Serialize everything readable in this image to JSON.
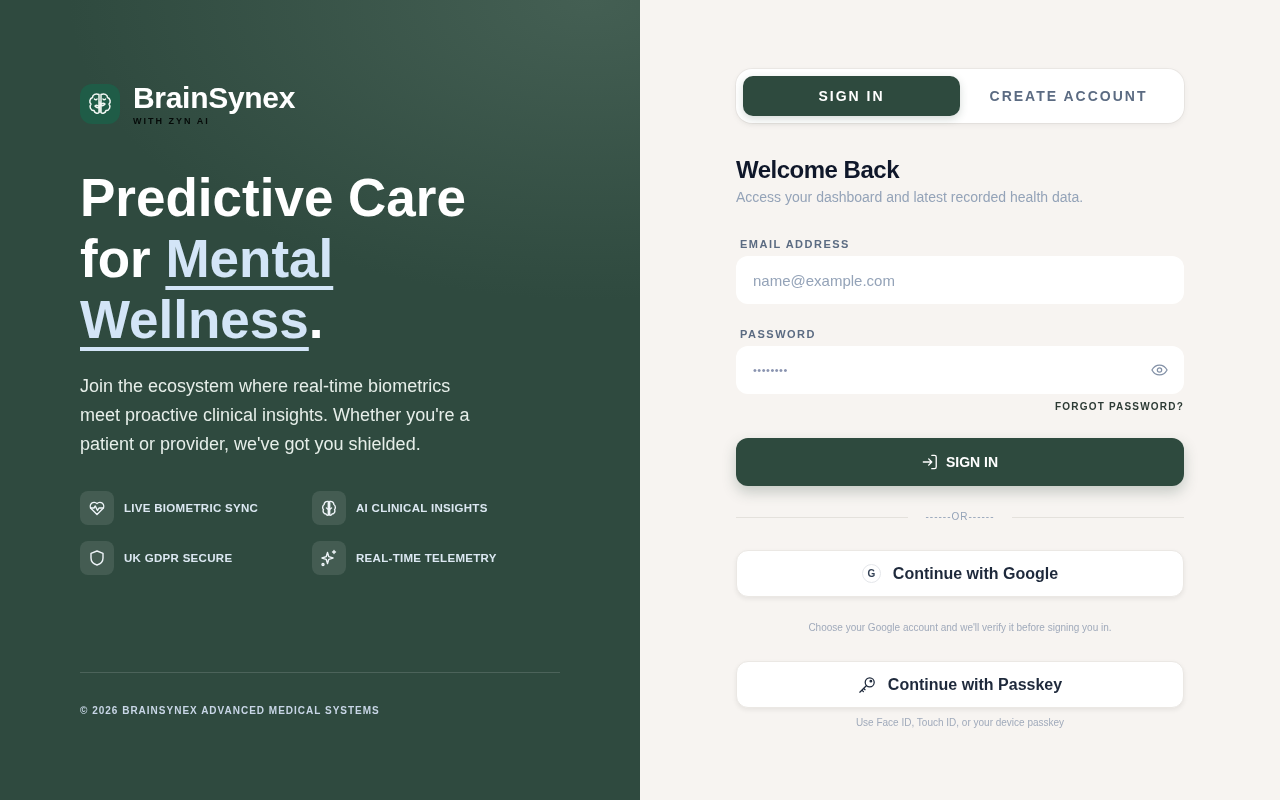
{
  "brand": {
    "name": "BrainSynex",
    "tagline": "WITH ZYN AI"
  },
  "hero": {
    "headline_start": "Predictive Care for",
    "headline_highlight": "Mental Wellness",
    "headline_end": ".",
    "body": "Join the ecosystem where real-time biometrics meet proactive clinical insights. Whether you're a patient or provider, we've got you shielded."
  },
  "features": [
    {
      "kind": "heart-pulse",
      "label": "LIVE BIOMETRIC SYNC"
    },
    {
      "kind": "brain",
      "label": "AI CLINICAL INSIGHTS"
    },
    {
      "kind": "shield",
      "label": "UK GDPR SECURE"
    },
    {
      "kind": "sparkle",
      "label": "REAL-TIME TELEMETRY"
    }
  ],
  "footer": "© 2026 BRAINSYNEX ADVANCED MEDICAL SYSTEMS",
  "auth": {
    "tabs": [
      {
        "label": "SIGN IN",
        "selected": true
      },
      {
        "label": "CREATE ACCOUNT",
        "selected": false
      }
    ],
    "title": "Welcome Back",
    "subtitle": "Access your dashboard and latest recorded health data.",
    "fields": [
      {
        "kind": "email",
        "label": "EMAIL ADDRESS",
        "placeholder": "name@example.com"
      },
      {
        "kind": "password",
        "label": "PASSWORD",
        "value": "••••••••"
      }
    ],
    "forgot_link": "FORGOT PASSWORD?",
    "submit": "SIGN IN",
    "divider": "------OR------",
    "providers": [
      {
        "kind": "google",
        "icon_text": "G",
        "label": "Continue with Google",
        "note": "Choose your Google account and we'll verify it before signing you in."
      },
      {
        "kind": "passkey",
        "label": "Continue with Passkey",
        "note": "Use Face ID, Touch ID, or your device passkey"
      }
    ]
  }
}
